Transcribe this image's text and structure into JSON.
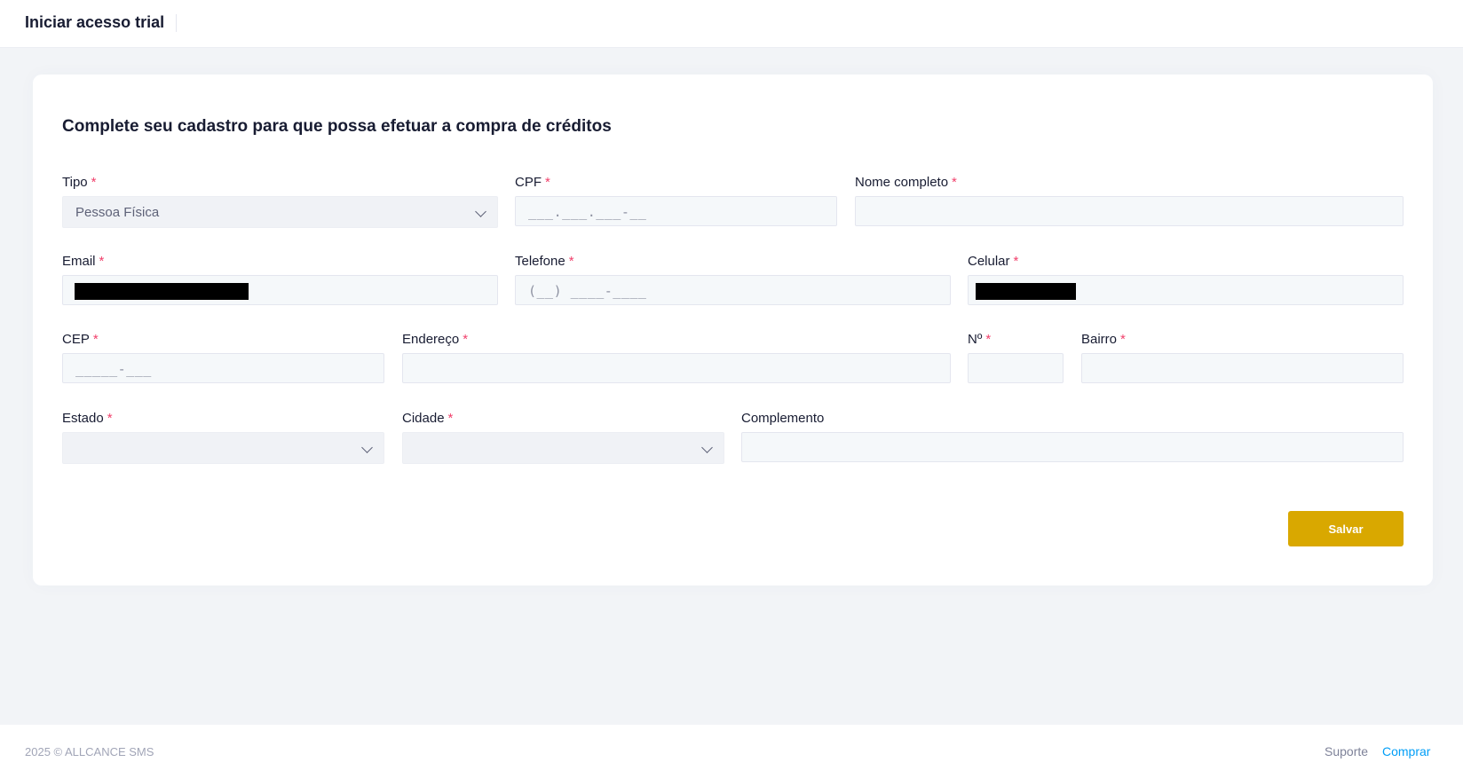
{
  "header": {
    "title": "Iniciar acesso trial"
  },
  "form": {
    "heading": "Complete seu cadastro para que possa efetuar a compra de créditos",
    "required_mark": "*",
    "fields": {
      "tipo": {
        "label": "Tipo",
        "value": "Pessoa Física"
      },
      "cpf": {
        "label": "CPF",
        "mask": "___.___.___-__"
      },
      "nome": {
        "label": "Nome completo",
        "value": ""
      },
      "email": {
        "label": "Email"
      },
      "telefone": {
        "label": "Telefone",
        "mask": "(__) ____-____"
      },
      "celular": {
        "label": "Celular"
      },
      "cep": {
        "label": "CEP",
        "mask": "_____-___"
      },
      "endereco": {
        "label": "Endereço",
        "value": ""
      },
      "numero": {
        "label": "Nº",
        "value": ""
      },
      "bairro": {
        "label": "Bairro",
        "value": ""
      },
      "estado": {
        "label": "Estado",
        "value": ""
      },
      "cidade": {
        "label": "Cidade",
        "value": ""
      },
      "complemento": {
        "label": "Complemento",
        "value": ""
      }
    },
    "save_label": "Salvar"
  },
  "footer": {
    "copyright": "2025 © ALLCANCE SMS",
    "links": [
      "Suporte",
      "Comprar"
    ]
  },
  "colors": {
    "accent": "#d9a800",
    "required": "#f1416c",
    "link": "#009ef7"
  }
}
